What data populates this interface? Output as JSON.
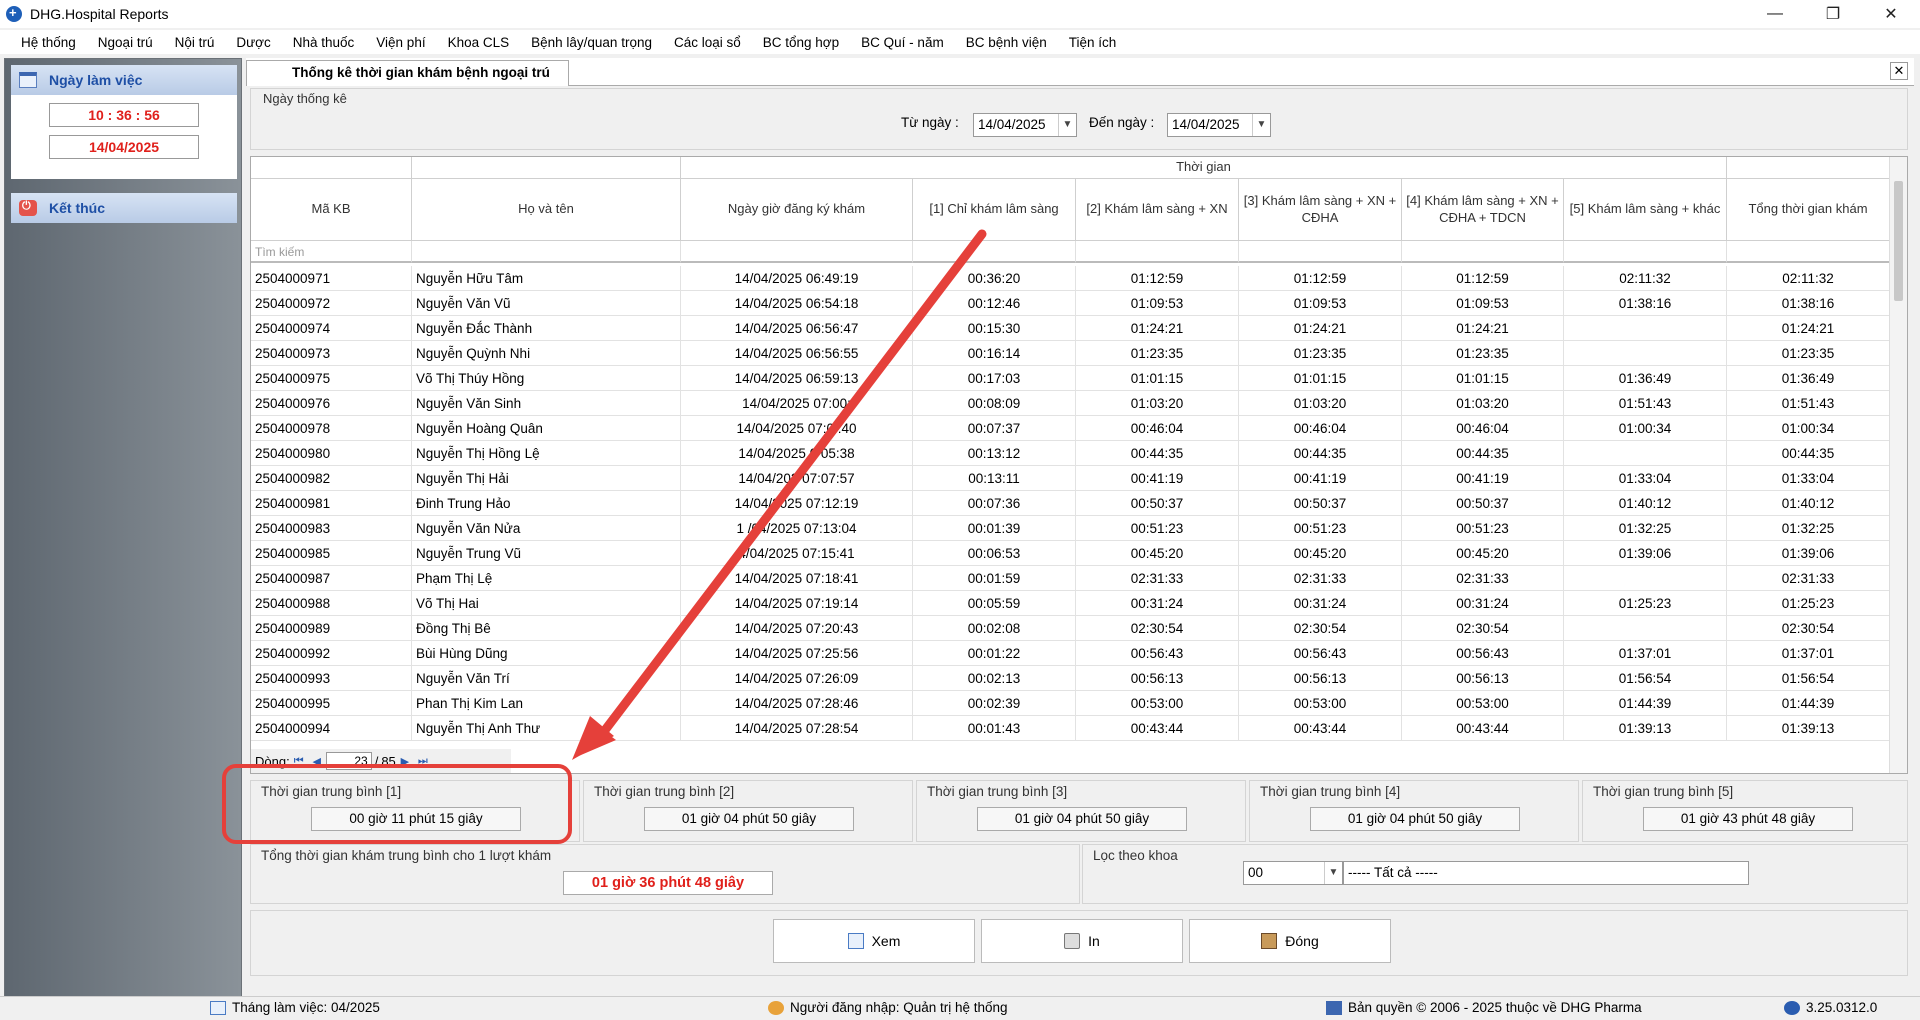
{
  "window": {
    "title": "DHG.Hospital Reports",
    "min": "—",
    "restore": "❐",
    "close": "✕"
  },
  "menu": [
    "Hệ thống",
    "Ngoại trú",
    "Nội trú",
    "Dược",
    "Nhà thuốc",
    "Viện phí",
    "Khoa CLS",
    "Bệnh lây/quan trọng",
    "Các loại sổ",
    "BC tổng hợp",
    "BC Quí - năm",
    "BC bệnh viện",
    "Tiện ích"
  ],
  "sidebar": {
    "work_day_label": "Ngày làm việc",
    "time": "10 : 36 : 56",
    "date": "14/04/2025",
    "exit_label": "Kết thúc"
  },
  "tab": {
    "title": "Thống kê thời gian khám bệnh ngoại trú",
    "close": "✕"
  },
  "date_filter": {
    "group_label": "Ngày thống kê",
    "from_label": "Từ ngày :",
    "from_value": "14/04/2025",
    "to_label": "Đến ngày :",
    "to_value": "14/04/2025"
  },
  "grid": {
    "group_header": "Thời gian",
    "columns": [
      "Mã KB",
      "Họ và tên",
      "Ngày giờ đăng ký khám",
      "[1] Chỉ khám lâm sàng",
      "[2] Khám lâm sàng + XN",
      "[3] Khám lâm sàng + XN + CĐHA",
      "[4] Khám lâm sàng + XN + CĐHA + TDCN",
      "[5] Khám lâm sàng + khác",
      "Tổng thời gian khám"
    ],
    "search_placeholder": "Tìm kiếm",
    "rows": [
      [
        "2504000971",
        "Nguyễn Hữu Tâm",
        "14/04/2025 06:49:19",
        "00:36:20",
        "01:12:59",
        "01:12:59",
        "01:12:59",
        "02:11:32",
        "02:11:32"
      ],
      [
        "2504000972",
        "Nguyễn Văn Vũ",
        "14/04/2025 06:54:18",
        "00:12:46",
        "01:09:53",
        "01:09:53",
        "01:09:53",
        "01:38:16",
        "01:38:16"
      ],
      [
        "2504000974",
        "Nguyễn Đắc Thành",
        "14/04/2025 06:56:47",
        "00:15:30",
        "01:24:21",
        "01:24:21",
        "01:24:21",
        "",
        "01:24:21"
      ],
      [
        "2504000973",
        "Nguyễn Quỳnh Nhi",
        "14/04/2025 06:56:55",
        "00:16:14",
        "01:23:35",
        "01:23:35",
        "01:23:35",
        "",
        "01:23:35"
      ],
      [
        "2504000975",
        "Võ Thị Thúy Hồng",
        "14/04/2025 06:59:13",
        "00:17:03",
        "01:01:15",
        "01:01:15",
        "01:01:15",
        "01:36:49",
        "01:36:49"
      ],
      [
        "2504000976",
        "Nguyễn Văn Sinh",
        "14/04/2025 07:00:",
        "00:08:09",
        "01:03:20",
        "01:03:20",
        "01:03:20",
        "01:51:43",
        "01:51:43"
      ],
      [
        "2504000978",
        "Nguyễn Hoàng Quân",
        "14/04/2025 07:0 :40",
        "00:07:37",
        "00:46:04",
        "00:46:04",
        "00:46:04",
        "01:00:34",
        "01:00:34"
      ],
      [
        "2504000980",
        "Nguyễn Thị Hồng Lệ",
        "14/04/2025 0 05:38",
        "00:13:12",
        "00:44:35",
        "00:44:35",
        "00:44:35",
        "",
        "00:44:35"
      ],
      [
        "2504000982",
        "Nguyễn Thị Hải",
        "14/04/202 07:07:57",
        "00:13:11",
        "00:41:19",
        "00:41:19",
        "00:41:19",
        "01:33:04",
        "01:33:04"
      ],
      [
        "2504000981",
        "Đinh Trung Hảo",
        "14/04/2025 07:12:19",
        "00:07:36",
        "00:50:37",
        "00:50:37",
        "00:50:37",
        "01:40:12",
        "01:40:12"
      ],
      [
        "2504000983",
        "Nguyễn Văn Nửa",
        "1 /04/2025 07:13:04",
        "00:01:39",
        "00:51:23",
        "00:51:23",
        "00:51:23",
        "01:32:25",
        "01:32:25"
      ],
      [
        "2504000985",
        "Nguyễn Trung Vũ",
        "4/04/2025 07:15:41",
        "00:06:53",
        "00:45:20",
        "00:45:20",
        "00:45:20",
        "01:39:06",
        "01:39:06"
      ],
      [
        "2504000987",
        "Phạm Thị Lệ",
        "14/04/2025 07:18:41",
        "00:01:59",
        "02:31:33",
        "02:31:33",
        "02:31:33",
        "",
        "02:31:33"
      ],
      [
        "2504000988",
        "Võ Thị Hai",
        "14/04/2025 07:19:14",
        "00:05:59",
        "00:31:24",
        "00:31:24",
        "00:31:24",
        "01:25:23",
        "01:25:23"
      ],
      [
        "2504000989",
        "Đồng Thị Bê",
        "14/04/2025 07:20:43",
        "00:02:08",
        "02:30:54",
        "02:30:54",
        "02:30:54",
        "",
        "02:30:54"
      ],
      [
        "2504000992",
        "Bùi Hùng Dũng",
        "14/04/2025 07:25:56",
        "00:01:22",
        "00:56:43",
        "00:56:43",
        "00:56:43",
        "01:37:01",
        "01:37:01"
      ],
      [
        "2504000993",
        "Nguyễn Văn Trí",
        "14/04/2025 07:26:09",
        "00:02:13",
        "00:56:13",
        "00:56:13",
        "00:56:13",
        "01:56:54",
        "01:56:54"
      ],
      [
        "2504000995",
        "Phan Thị Kim Lan",
        "14/04/2025 07:28:46",
        "00:02:39",
        "00:53:00",
        "00:53:00",
        "00:53:00",
        "01:44:39",
        "01:44:39"
      ],
      [
        "2504000994",
        "Nguyễn Thị Anh Thư",
        "14/04/2025 07:28:54",
        "00:01:43",
        "00:43:44",
        "00:43:44",
        "00:43:44",
        "01:39:13",
        "01:39:13"
      ]
    ],
    "pager": {
      "label": "Dòng:",
      "current": "23",
      "sep": "/",
      "total": "85"
    }
  },
  "averages": [
    {
      "label": "Thời gian trung bình [1]",
      "value": "00 giờ 11 phút 15 giây"
    },
    {
      "label": "Thời gian trung bình [2]",
      "value": "01 giờ 04 phút 50 giây"
    },
    {
      "label": "Thời gian trung bình [3]",
      "value": "01 giờ 04 phút 50 giây"
    },
    {
      "label": "Thời gian trung bình [4]",
      "value": "01 giờ 04 phút 50 giây"
    },
    {
      "label": "Thời gian trung bình [5]",
      "value": "01 giờ 43 phút 48 giây"
    }
  ],
  "total": {
    "label": "Tổng thời gian khám trung bình cho 1 lượt khám",
    "value": "01 giờ 36 phút 48 giây"
  },
  "department_filter": {
    "label": "Lọc theo khoa",
    "code": "00",
    "name": "----- Tất cả -----"
  },
  "buttons": {
    "view": "Xem",
    "print": "In",
    "close": "Đóng"
  },
  "status": {
    "month": "Tháng làm việc: 04/2025",
    "user": "Người đăng nhập: Quản trị hệ thống",
    "copyright": "Bản quyền © 2006 - 2025 thuộc về DHG Pharma",
    "version": "3.25.0312.0"
  },
  "colors": {
    "annotation": "#e5403a",
    "highlight_text": "#e0201b",
    "sidebar_head": "#1e4fa5"
  }
}
